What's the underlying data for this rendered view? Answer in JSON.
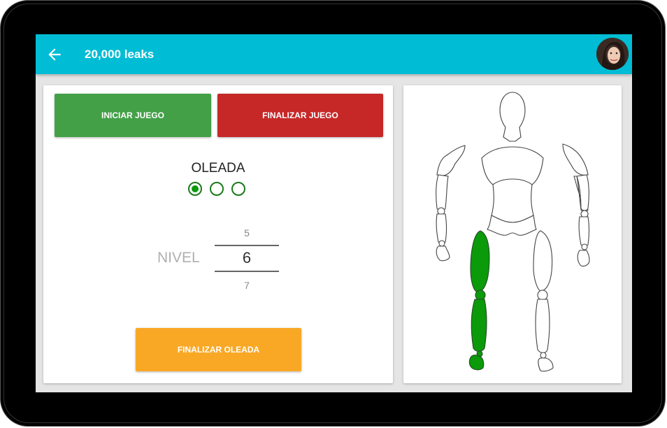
{
  "header": {
    "title": "20,000 leaks",
    "back_icon": "arrow-left-icon",
    "avatar_icon": "user-avatar"
  },
  "controls": {
    "start_label": "INICIAR JUEGO",
    "end_label": "FINALIZAR JUEGO"
  },
  "wave": {
    "label": "OLEADA",
    "options": [
      "wave-1",
      "wave-2",
      "wave-3"
    ],
    "selected": 0
  },
  "level": {
    "label": "NIVEL",
    "prev": "5",
    "current": "6",
    "next": "7"
  },
  "finish_wave_label": "FINALIZAR OLEADA",
  "body_map": {
    "highlighted_part": "right-leg",
    "highlight_color": "#0a9a0a"
  },
  "colors": {
    "appbar": "#00bcd4",
    "start": "#43a047",
    "end": "#c62828",
    "wave": "#f9a825"
  }
}
